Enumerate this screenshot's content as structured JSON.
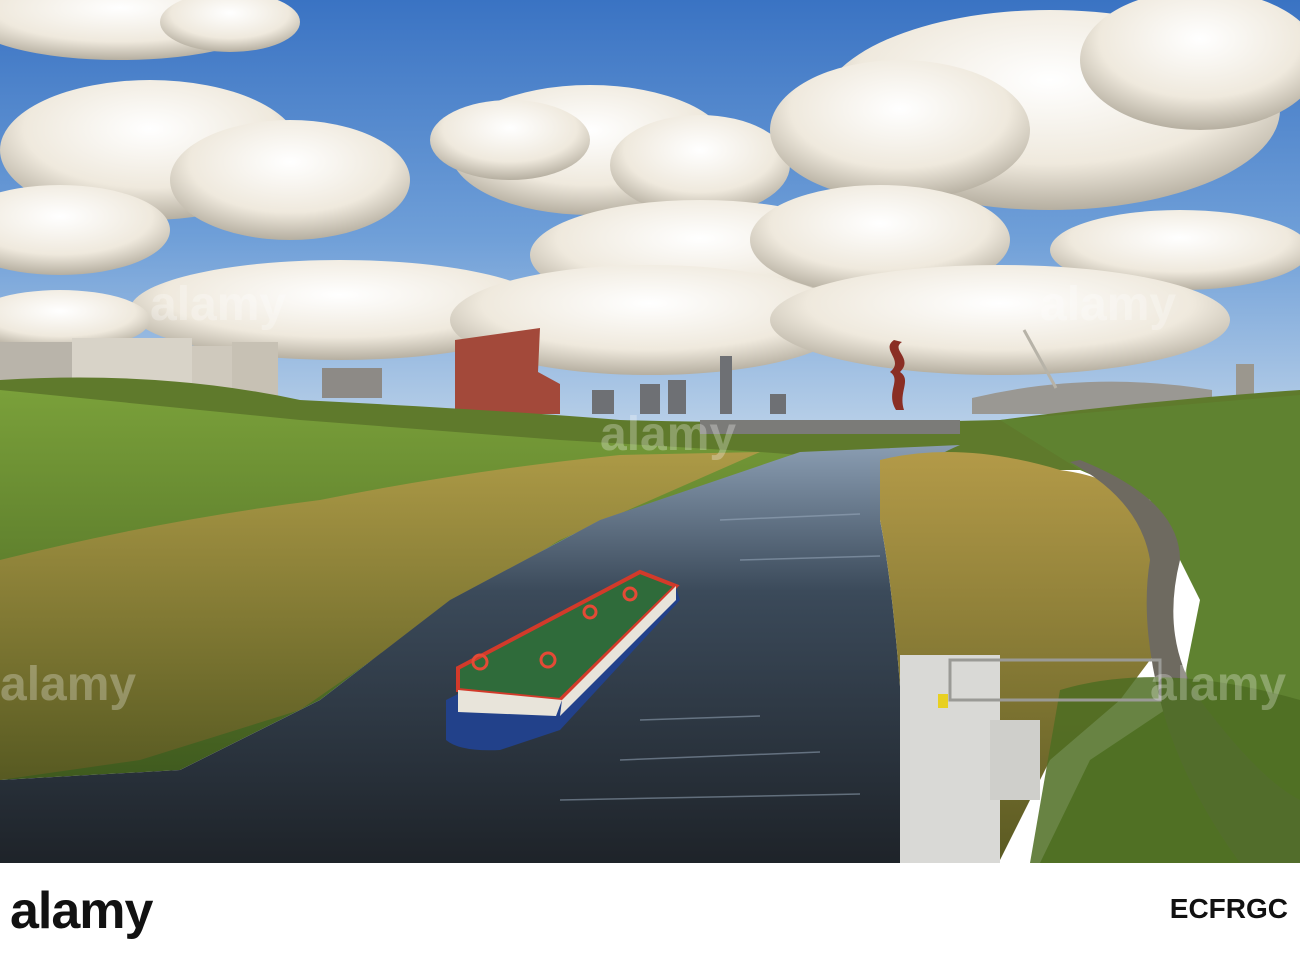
{
  "footer": {
    "brand": "alamy",
    "image_code": "ECFRGC"
  },
  "watermark": {
    "text": "alamy"
  },
  "colors": {
    "sky_top": "#3f78c6",
    "sky_bottom": "#9fc1e6",
    "cloud": "#f4f1ea",
    "cloud_shadow": "#b9b3a6",
    "water": "#2b3138",
    "grass": "#6f8f30",
    "reeds": "#9a8a3c",
    "boat_roof": "#2f6b3a",
    "boat_hull": "#22418a",
    "boat_trim": "#d23a2a",
    "footer_bg": "#ffffff",
    "logo": "#111111"
  }
}
